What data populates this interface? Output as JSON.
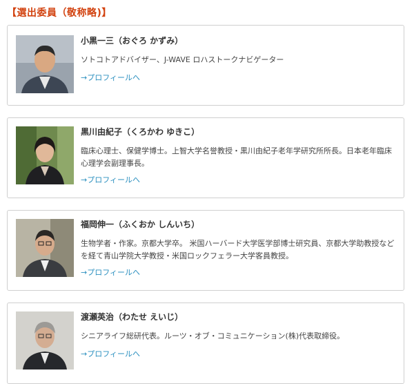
{
  "section": {
    "heading": "【選出委員（敬称略)】"
  },
  "members": [
    {
      "name": "小黒一三（おぐろ かずみ）",
      "description": "ソトコトアドバイザー、J-WAVE ロハストークナビゲーター",
      "profile_link": "→プロフィールへ"
    },
    {
      "name": "黒川由紀子（くろかわ ゆきこ）",
      "description": "臨床心理士、保健学博士。上智大学名誉教授・黒川由紀子老年学研究所所長。日本老年臨床心理学会副理事長。",
      "profile_link": "→プロフィールへ"
    },
    {
      "name": "福岡伸一（ふくおか しんいち）",
      "description": "生物学者・作家。京都大学卒。 米国ハーバード大学医学部博士研究員、京都大学助教授などを経て青山学院大学教授・米国ロックフェラー大学客員教授。",
      "profile_link": "→プロフィールへ"
    },
    {
      "name": "渡瀬英治（わたせ えいじ）",
      "description": "シニアライフ総研代表。ルーツ・オブ・コミュニケーション(株)代表取締役。",
      "profile_link": "→プロフィールへ"
    }
  ]
}
